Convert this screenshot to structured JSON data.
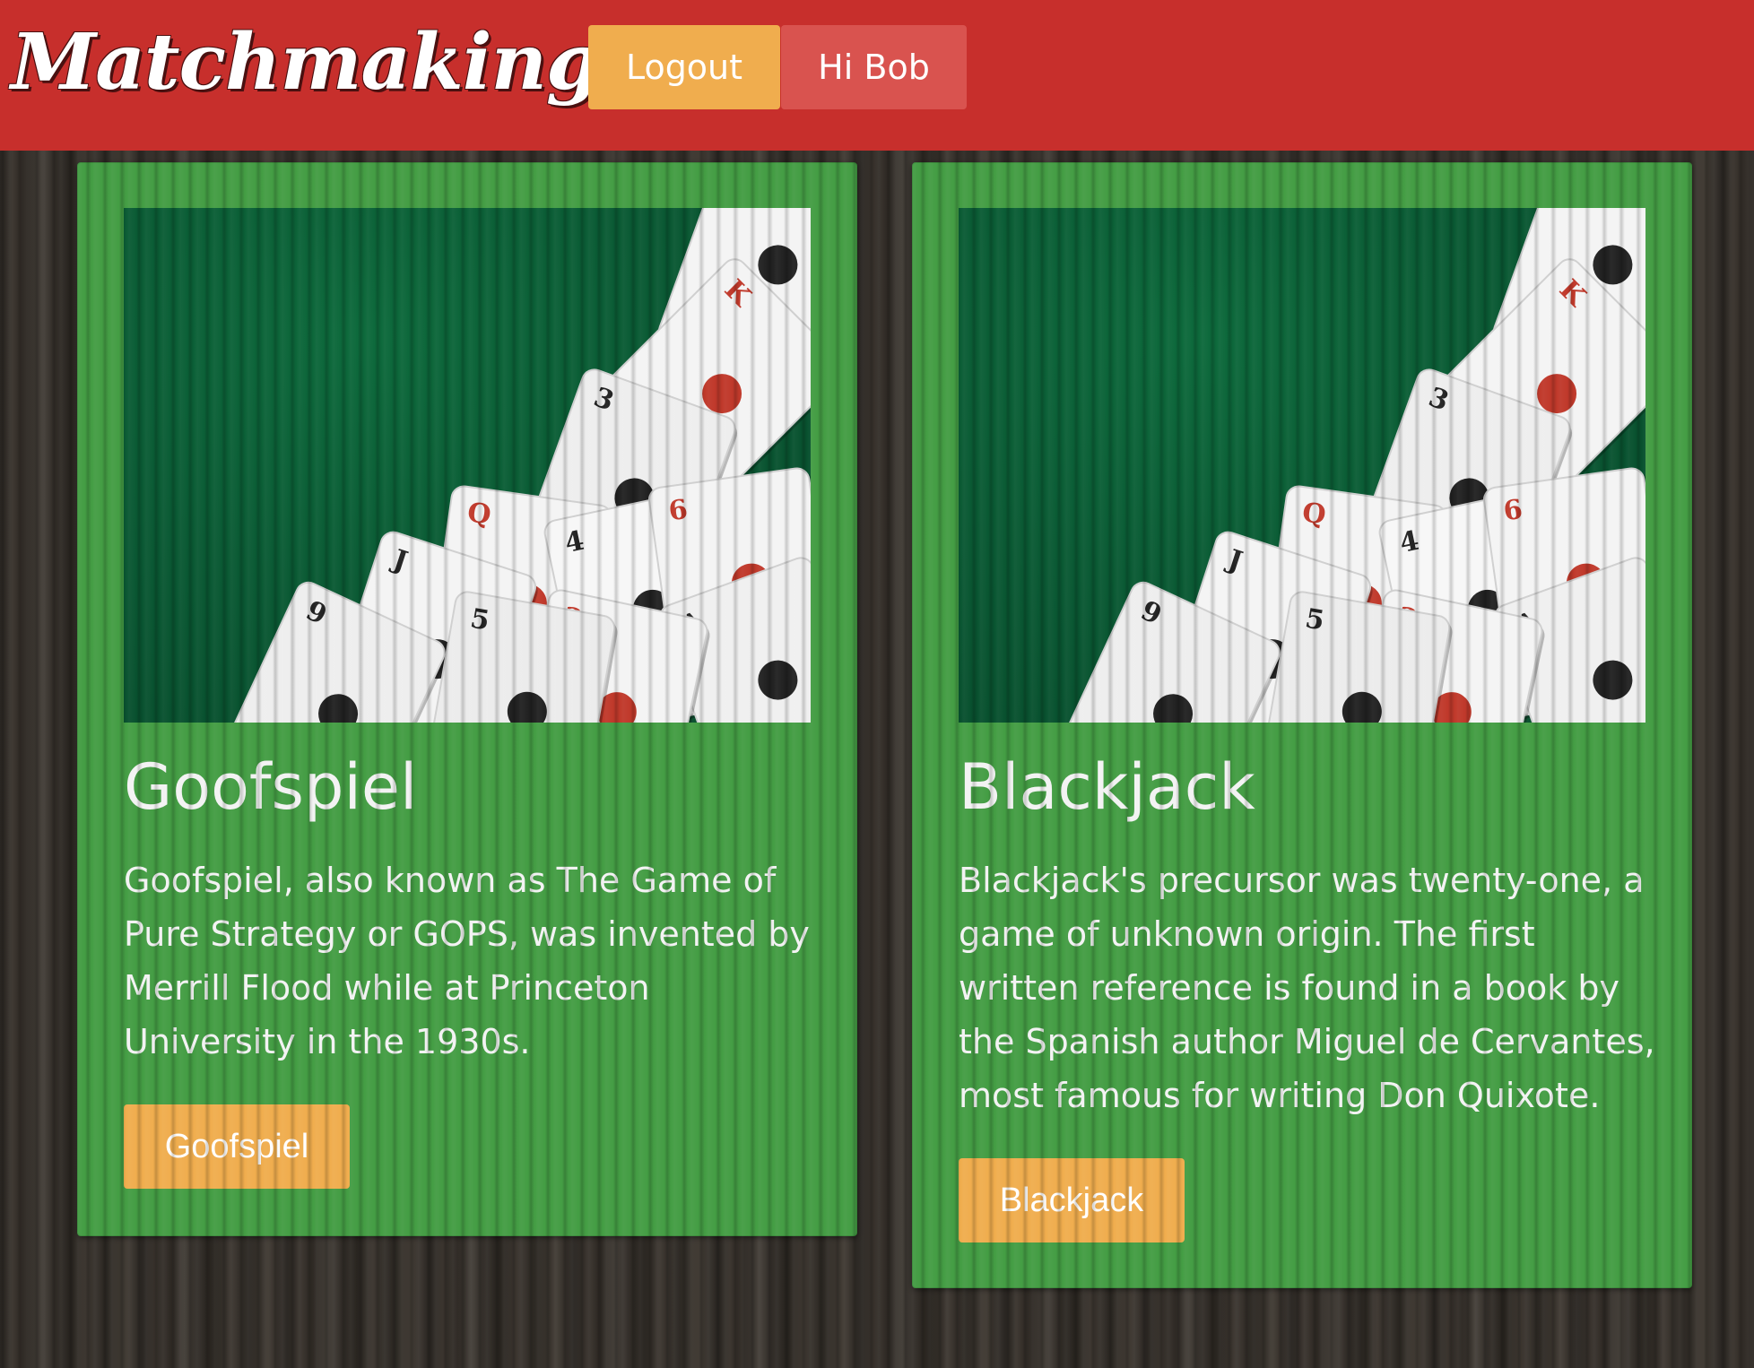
{
  "navbar": {
    "brand": "Matchmaking",
    "logout_label": "Logout",
    "greeting_label": "Hi Bob",
    "brand_color": "#c72f2c",
    "logout_color": "#f0ad4e",
    "greeting_color": "#d9534f"
  },
  "games": [
    {
      "title": "Goofspiel",
      "description": "Goofspiel, also known as The Game of Pure Strategy or GOPS, was invented by Merrill Flood while at Princeton University in the 1930s.",
      "button_label": "Goofspiel",
      "image_icon": "playing-cards-image"
    },
    {
      "title": "Blackjack",
      "description": "Blackjack's precursor was twenty-one, a game of unknown origin. The first written reference is found in a book by the Spanish author Miguel de Cervantes, most famous for writing Don Quixote.",
      "button_label": "Blackjack",
      "image_icon": "playing-cards-image"
    }
  ],
  "colors": {
    "card_bg": "#449d44",
    "button_bg": "#f0ad4e"
  }
}
